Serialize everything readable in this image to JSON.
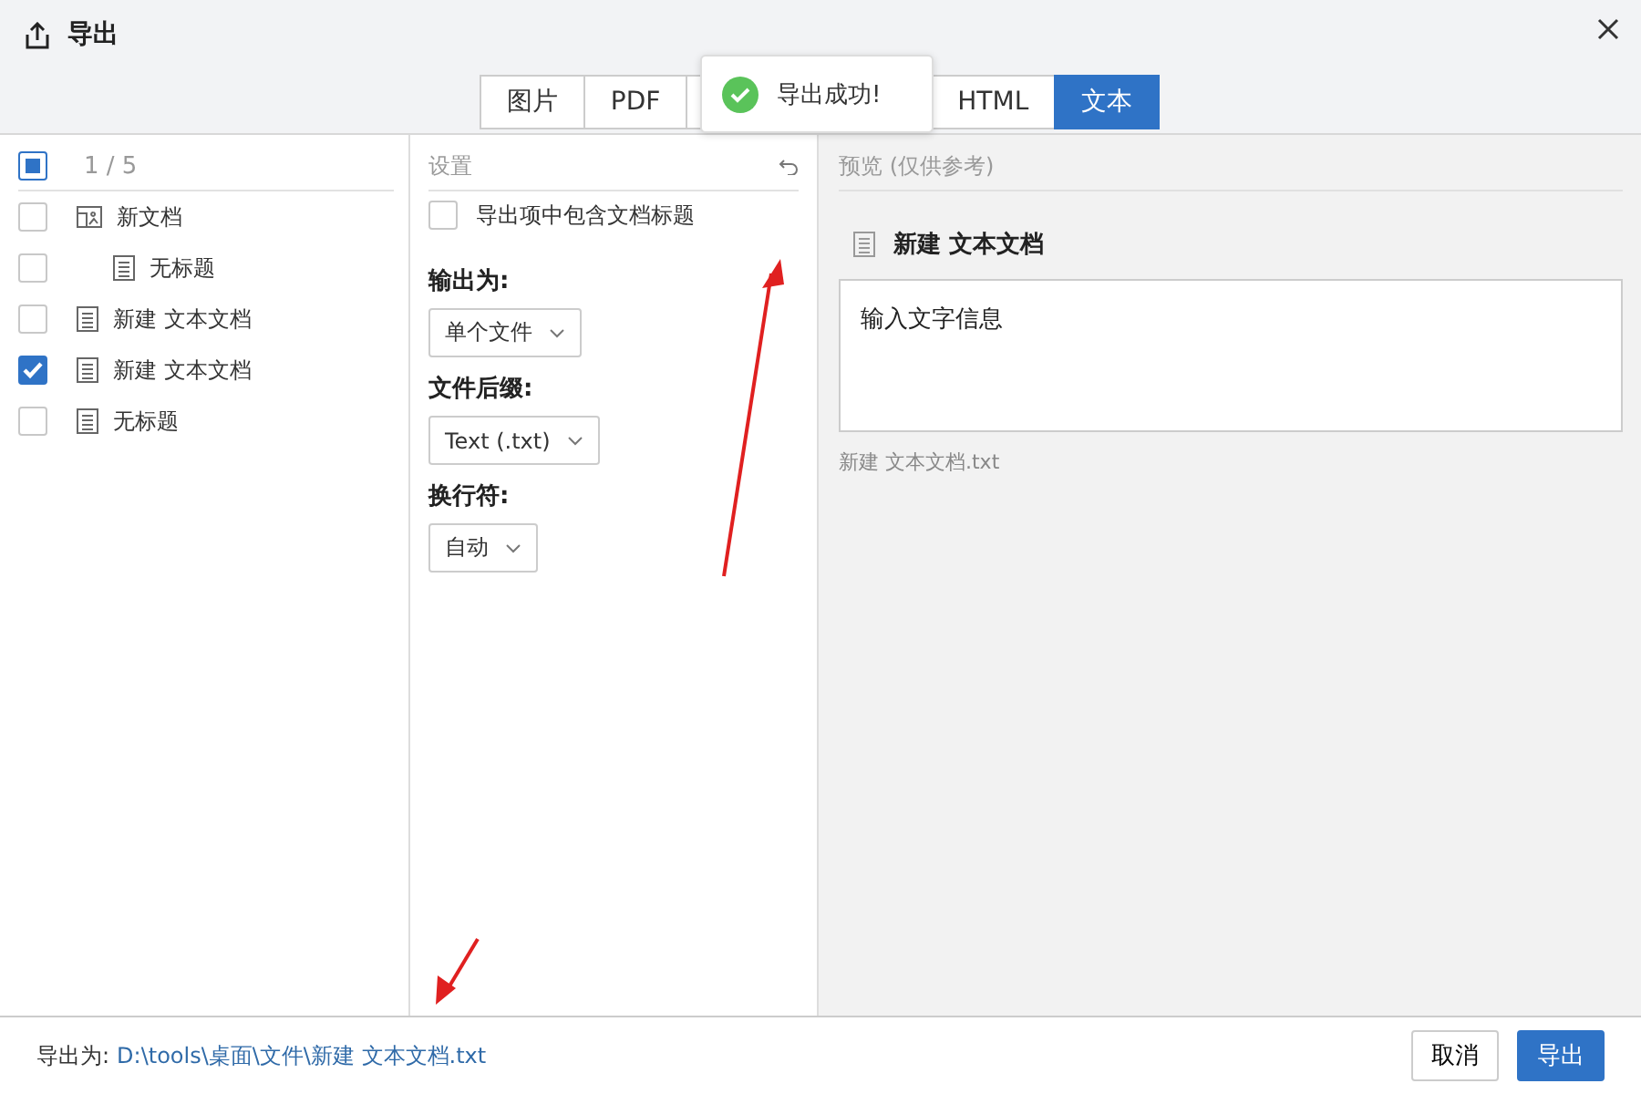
{
  "window": {
    "title": "导出"
  },
  "tabs": [
    {
      "label": "图片",
      "selected": false
    },
    {
      "label": "PDF",
      "selected": false
    },
    {
      "label": "HTML",
      "selected": false
    },
    {
      "label": "文本",
      "selected": true
    }
  ],
  "toast": {
    "message": "导出成功!"
  },
  "doc_list": {
    "count": "1 / 5",
    "all_indeterminate": true,
    "items": [
      {
        "label": "新文档",
        "kind": "folder",
        "checked": false,
        "children": [
          {
            "label": "无标题",
            "kind": "doc",
            "checked": false
          }
        ]
      },
      {
        "label": "新建 文本文档",
        "kind": "doc",
        "checked": false
      },
      {
        "label": "新建 文本文档",
        "kind": "doc",
        "checked": true
      },
      {
        "label": "无标题",
        "kind": "doc",
        "checked": false
      }
    ]
  },
  "settings": {
    "title": "设置",
    "include_title": {
      "label": "导出项中包含文档标题",
      "checked": false
    },
    "fields": [
      {
        "label": "输出为:",
        "value": "单个文件"
      },
      {
        "label": "文件后缀:",
        "value": "Text (.txt)"
      },
      {
        "label": "换行符:",
        "value": "自动"
      }
    ]
  },
  "preview": {
    "title": "预览 (仅供参考)",
    "doc_title": "新建 文本文档",
    "content": "输入文字信息",
    "filename": "新建 文本文档.txt"
  },
  "footer": {
    "label": "导出为:",
    "path": "D:\\tools\\桌面\\文件\\新建 文本文档.txt",
    "buttons": [
      "取消",
      "导出"
    ]
  }
}
